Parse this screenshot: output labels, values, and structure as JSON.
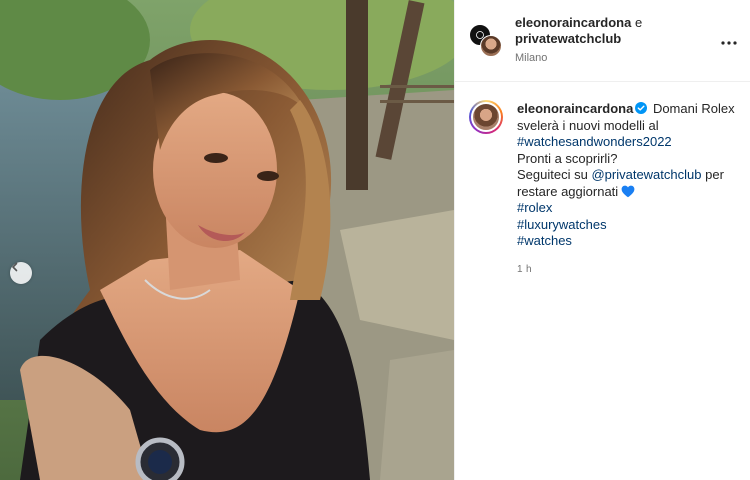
{
  "header": {
    "user_primary": "eleonoraincardona",
    "conjunction": "e",
    "user_secondary": "privatewatchclub",
    "location": "Milano",
    "more_icon": "more-options-icon"
  },
  "caption": {
    "username": "eleonoraincardona",
    "text_1": "Domani Rolex",
    "text_2": "svelerà i nuovi modelli al",
    "hashtag_1": "#watchesandwonders2022",
    "text_3": "Pronti a scoprirli?",
    "text_4": "Seguiteci su",
    "mention": "@privatewatchclub",
    "text_5": "per",
    "text_6": "restare aggiornati",
    "hashtag_2": "#rolex",
    "hashtag_3": "#luxurywatches",
    "hashtag_4": "#watches",
    "heart_color": "#1a7ff2",
    "timestamp": "1 h"
  },
  "media": {
    "prev_icon": "chevron-left-icon"
  },
  "colors": {
    "link": "#00376b",
    "verified": "#0095f6",
    "text": "#262626",
    "muted": "#737373"
  }
}
